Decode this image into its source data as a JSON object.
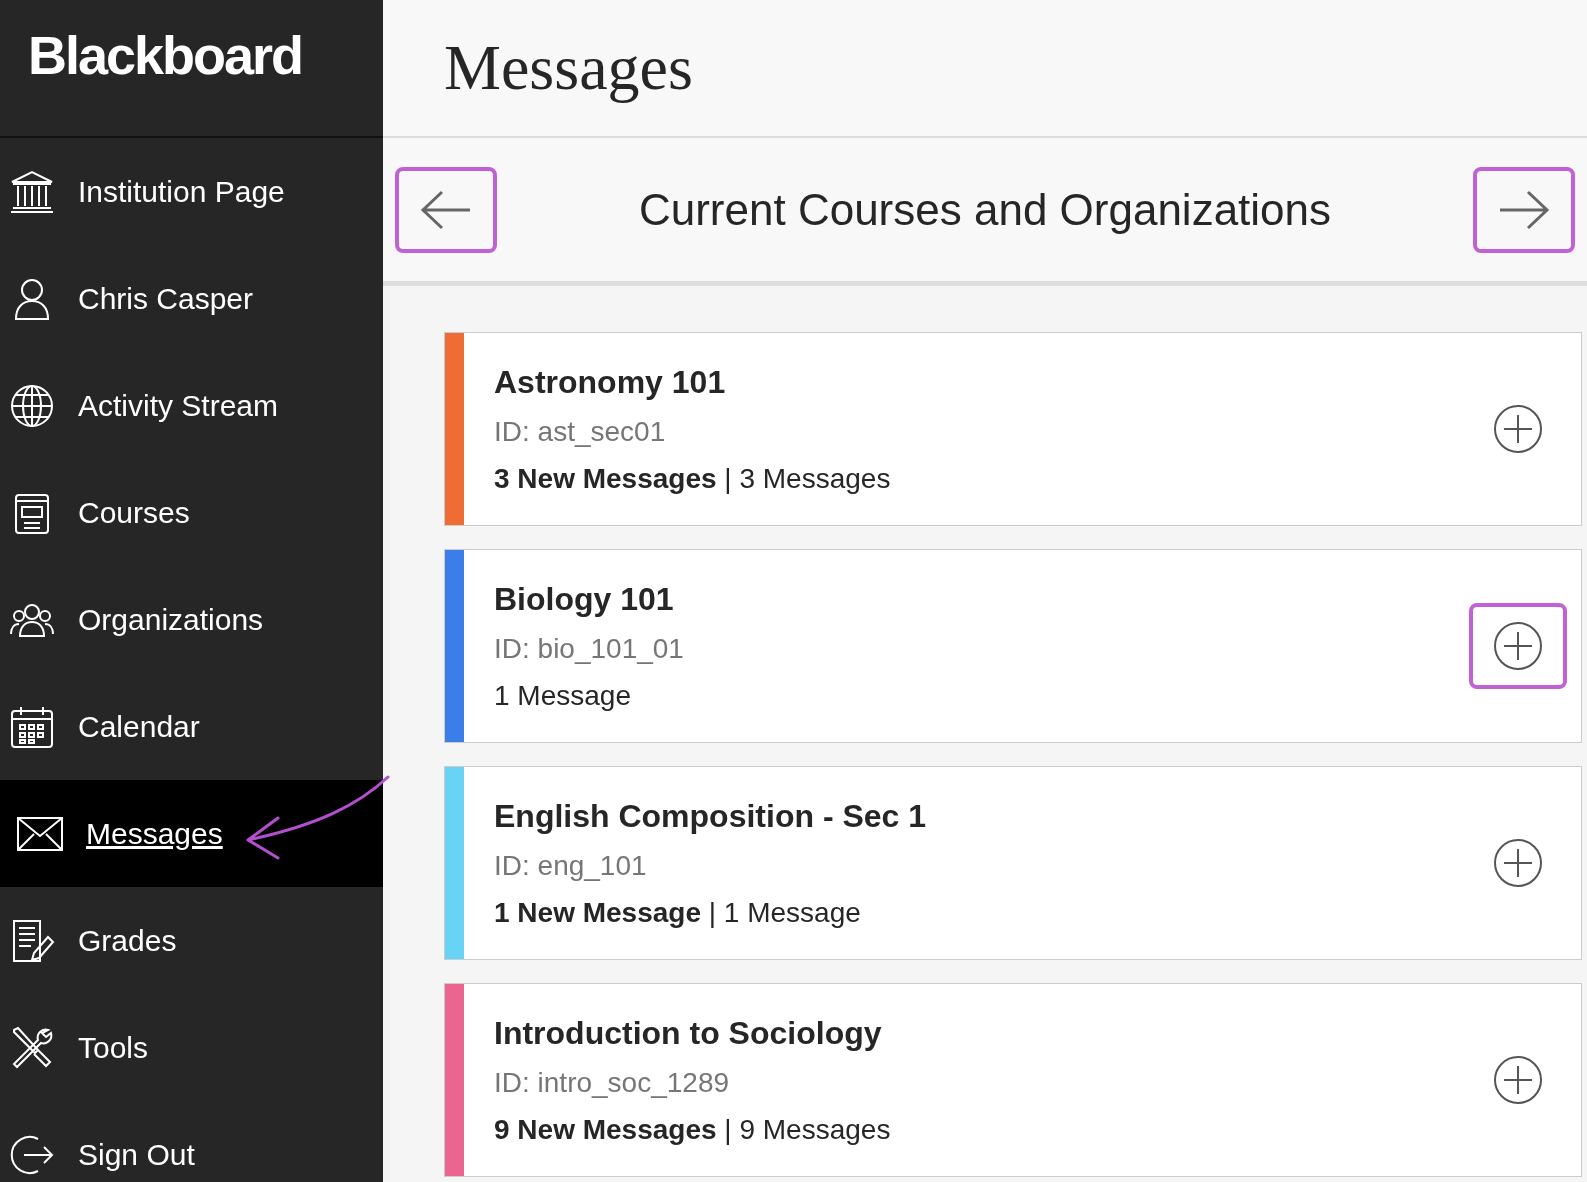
{
  "sidebar": {
    "logo": "Blackboard",
    "items": [
      {
        "label": "Institution Page",
        "kind": "institution",
        "selected": false
      },
      {
        "label": "Chris Casper",
        "kind": "person",
        "selected": false
      },
      {
        "label": "Activity Stream",
        "kind": "globe",
        "selected": false
      },
      {
        "label": "Courses",
        "kind": "book",
        "selected": false
      },
      {
        "label": "Organizations",
        "kind": "people",
        "selected": false
      },
      {
        "label": "Calendar",
        "kind": "calendar",
        "selected": false
      },
      {
        "label": "Messages",
        "kind": "envelope",
        "selected": true
      },
      {
        "label": "Grades",
        "kind": "grades",
        "selected": false
      },
      {
        "label": "Tools",
        "kind": "tools",
        "selected": false
      },
      {
        "label": "Sign Out",
        "kind": "signout",
        "selected": false
      }
    ]
  },
  "page_title": "Messages",
  "nav": {
    "title": "Current Courses and Organizations",
    "prev_highlighted": true,
    "next_highlighted": true
  },
  "courses": [
    {
      "title": "Astronomy 101",
      "id": "ID: ast_sec01",
      "messages": "**3 New Messages** | 3 Messages",
      "color": "#ef6c35",
      "highlighted": false
    },
    {
      "title": "Biology 101",
      "id": "ID: bio_101_01",
      "messages": "1 Message",
      "color": "#3b7de9",
      "highlighted": true
    },
    {
      "title": "English Composition - Sec 1",
      "id": "ID: eng_101",
      "messages": "**1 New Message** | 1 Message",
      "color": "#69d3f5",
      "highlighted": false
    },
    {
      "title": "Introduction to Sociology",
      "id": "ID: intro_soc_1289",
      "messages": "**9 New Messages** | 9 Messages",
      "color": "#ea6690",
      "highlighted": false
    }
  ]
}
